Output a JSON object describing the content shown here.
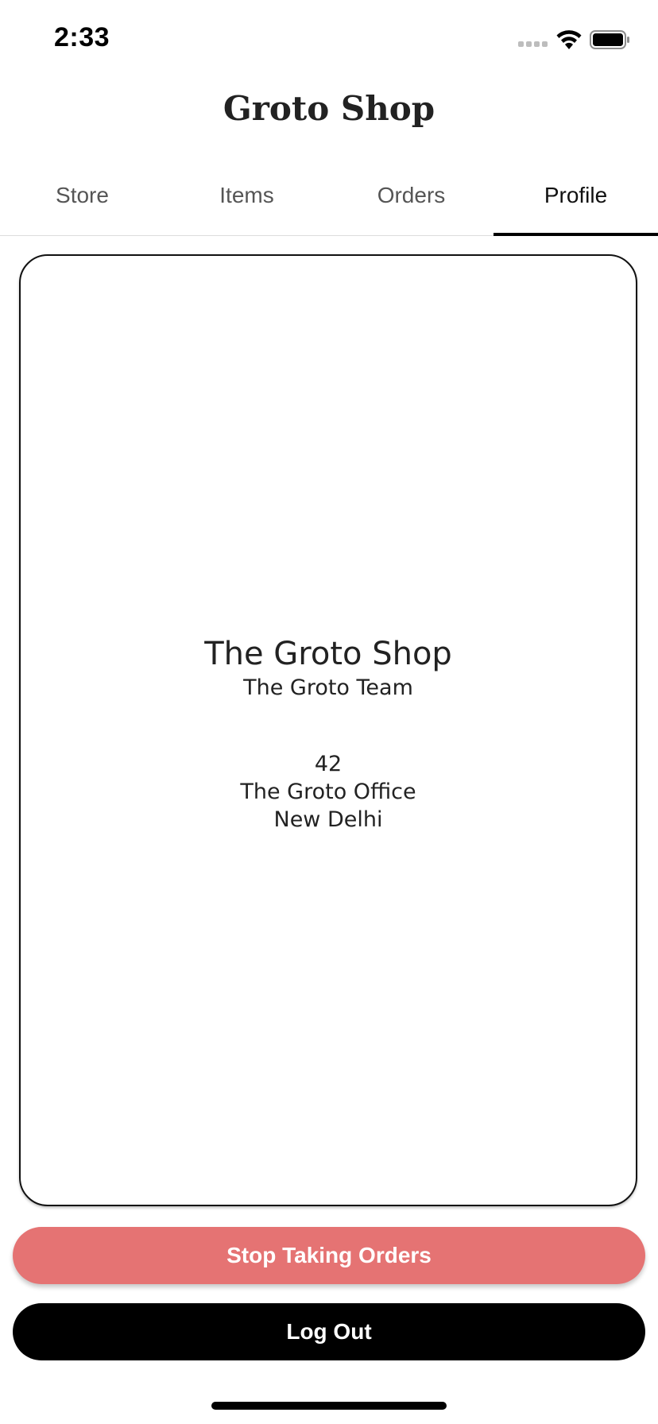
{
  "status_bar": {
    "time": "2:33",
    "signal_icon": "cellular-signal-icon",
    "wifi_icon": "wifi-icon",
    "battery_icon": "battery-icon"
  },
  "header": {
    "title": "Groto Shop"
  },
  "tabs": [
    {
      "label": "Store",
      "active": false
    },
    {
      "label": "Items",
      "active": false
    },
    {
      "label": "Orders",
      "active": false
    },
    {
      "label": "Profile",
      "active": true
    }
  ],
  "profile": {
    "shop_name": "The Groto Shop",
    "team_name": "The Groto Team",
    "address": {
      "line1": "42",
      "line2": "The Groto Office",
      "line3": "New Delhi"
    }
  },
  "actions": {
    "stop_orders_label": "Stop Taking Orders",
    "logout_label": "Log Out"
  },
  "colors": {
    "stop_button": "#e57373",
    "logout_button": "#000000",
    "active_tab_indicator": "#000000"
  }
}
